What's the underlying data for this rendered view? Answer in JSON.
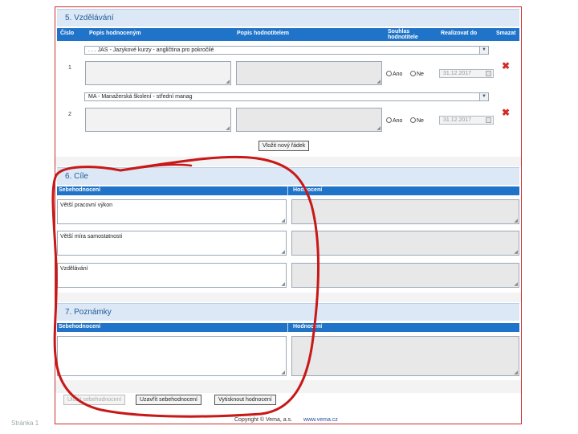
{
  "section5": {
    "title": "5. Vzdělávání",
    "columns": {
      "cislo": "Číslo",
      "popis_hodnoceny": "Popis hodnoceným",
      "popis_hodnotitel": "Popis hodnotitelem",
      "souhlas": "Souhlas hodnotitele",
      "realizovat": "Realizovat do",
      "smazat": "Smazat"
    },
    "rows": [
      {
        "number": "1",
        "selected": ". . . JAS - Jazykové kurzy - angličtina pro pokročilé",
        "yes": "Ano",
        "no": "Ne",
        "date": "31.12.2017"
      },
      {
        "number": "2",
        "selected": "MA - Manažerská školení - střední manag",
        "yes": "Ano",
        "no": "Ne",
        "date": "31.12.2017"
      }
    ],
    "add_row": "Vložit nový řádek"
  },
  "section6": {
    "title": "6. Cíle",
    "col_self": "Sebehodnocení",
    "col_eval": "Hodnocení",
    "goals": [
      "Větší pracovní výkon",
      "Větší míra samostatnosti",
      "Vzdělávání"
    ]
  },
  "section7": {
    "title": "7. Poznámky",
    "col_self": "Sebehodnocení",
    "col_eval": "Hodnocení"
  },
  "buttons": {
    "save": "Uložit sebehodnocení",
    "close": "Uzavřít sebehodnocení",
    "print": "Vytisknout hodnocení"
  },
  "footer": {
    "page": "Stránka 1",
    "copyright": "Copyright © Vema, a.s.",
    "link": "www.vema.cz"
  },
  "colors": {
    "accent": "#1f73c8",
    "annotation": "#c81818",
    "delete": "#d42a2a"
  }
}
